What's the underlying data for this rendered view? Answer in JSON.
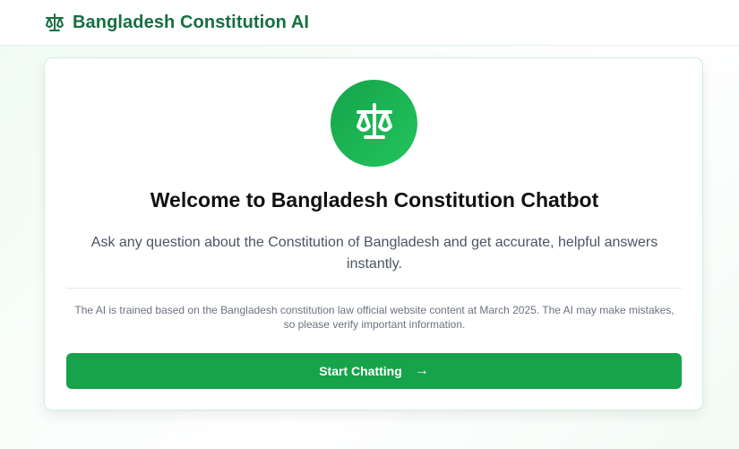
{
  "header": {
    "title": "Bangladesh Constitution AI",
    "icon": "scale-icon",
    "brand_color": "#15703f"
  },
  "welcome": {
    "icon": "scale-icon",
    "title": "Welcome to Bangladesh Constitution Chatbot",
    "subtitle": "Ask any question about the Constitution of Bangladesh and get accurate, helpful answers instantly.",
    "disclaimer": "The AI is trained based on the Bangladesh constitution law official website content at March 2025. The AI may make mistakes, so please verify important information.",
    "button_label": "Start Chatting",
    "button_icon": "arrow-right-icon",
    "accent_color": "#16a34a"
  }
}
